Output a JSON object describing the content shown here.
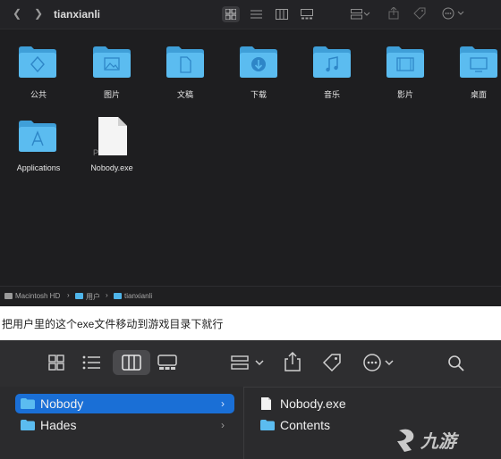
{
  "window1": {
    "title": "tianxianli",
    "nav_back_icon": "chevron-left-icon",
    "nav_forward_icon": "chevron-right-icon",
    "items": [
      {
        "label": "公共",
        "icon": "shared-folder"
      },
      {
        "label": "图片",
        "icon": "pictures-folder"
      },
      {
        "label": "文稿",
        "icon": "documents-folder"
      },
      {
        "label": "下载",
        "icon": "downloads-folder"
      },
      {
        "label": "音乐",
        "icon": "music-folder"
      },
      {
        "label": "影片",
        "icon": "movies-folder"
      },
      {
        "label": "桌面",
        "icon": "desktop-folder"
      },
      {
        "label": "Applications",
        "icon": "applications-folder"
      },
      {
        "label": "Nobody.exe",
        "icon": "exe-file"
      }
    ],
    "pathbar": {
      "disk": "Macintosh HD",
      "users": "用户",
      "home": "tianxianli"
    }
  },
  "caption": "把用户里的这个exe文件移动到游戏目录下就行",
  "window2": {
    "sidebar": [
      {
        "label": "Nobody",
        "selected": true
      },
      {
        "label": "Hades",
        "selected": false
      }
    ],
    "column2": [
      {
        "label": "Nobody.exe",
        "icon": "exe-file"
      },
      {
        "label": "Contents",
        "icon": "folder"
      }
    ],
    "watermark": "九游"
  },
  "colors": {
    "folder_blue": "#4fb5ea",
    "selection_blue": "#1a6fd6",
    "dark_bg": "#1e1e20"
  }
}
